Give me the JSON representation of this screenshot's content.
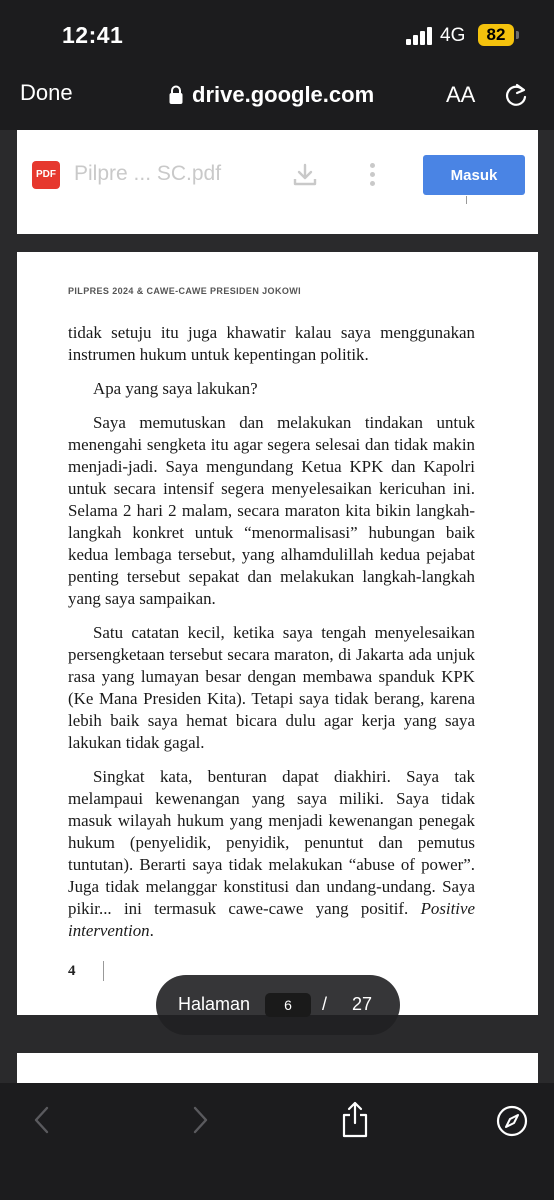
{
  "status_bar": {
    "time": "12:41",
    "network": "4G",
    "battery": "82"
  },
  "browser": {
    "done_label": "Done",
    "url": "drive.google.com",
    "text_size_label": "AA"
  },
  "drive": {
    "file_badge": "PDF",
    "file_title": "Pilpre ... SC.pdf",
    "sign_in_label": "Masuk"
  },
  "page": {
    "running_head": "PILPRES 2024 & CAWE-CAWE PRESIDEN JOKOWI",
    "paragraphs": [
      "tidak setuju itu juga khawatir kalau saya menggunakan instrumen hukum untuk kepentingan politik.",
      "Apa yang saya lakukan?",
      "Saya memutuskan dan melakukan tindakan untuk menengahi sengketa itu agar segera selesai dan tidak makin menjadi-jadi. Saya mengundang Ketua KPK dan Kapolri untuk secara intensif segera menyelesaikan kericuhan ini. Selama 2 hari 2 malam, secara maraton kita bikin langkah-langkah konkret untuk “menormalisasi” hubungan baik kedua lembaga tersebut, yang alhamdulillah kedua pejabat penting tersebut sepakat dan melakukan langkah-langkah yang saya sampaikan.",
      "Satu catatan kecil, ketika saya tengah menyelesaikan persengketaan tersebut secara maraton, di Jakarta ada unjuk rasa yang lumayan besar dengan membawa spanduk KPK (Ke Mana Presiden Kita). Tetapi saya tidak berang, karena lebih baik saya hemat bicara dulu agar kerja yang saya lakukan tidak gagal."
    ],
    "last_paragraph": "Singkat kata, benturan dapat diakhiri. Saya tak melampaui kewenangan yang saya miliki. Saya tidak masuk wilayah hukum yang menjadi kewenangan penegak hukum (penyelidik, penyidik, penuntut dan pemutus tuntutan). Berarti saya tidak melakukan “abuse of power”. Juga tidak melanggar konstitusi dan undang-undang. Saya pikir... ini termasuk cawe-cawe yang positif.",
    "last_paragraph_italic": "Positive intervention",
    "last_paragraph_end": ".",
    "page_number": "4"
  },
  "page_indicator": {
    "label": "Halaman",
    "current": "6",
    "separator": "/",
    "total": "27"
  },
  "colors": {
    "chrome": "#1c1c1e",
    "accent": "#4a84e4",
    "pdf_red": "#e6382e",
    "battery": "#f4c20d"
  },
  "icons": [
    "lock-icon",
    "reload-icon",
    "download-icon",
    "more-vert-icon",
    "back-chevron-icon",
    "forward-chevron-icon",
    "share-icon",
    "compass-icon"
  ]
}
